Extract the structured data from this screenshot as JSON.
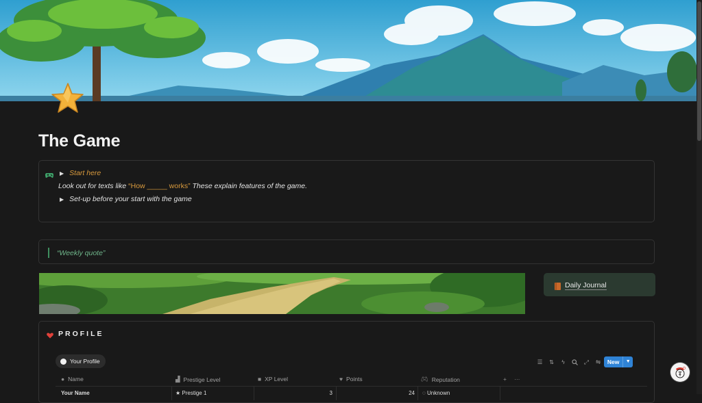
{
  "page": {
    "title": "The Game",
    "icon": "star-icon"
  },
  "callout": {
    "icon": "gamepad-icon",
    "toggle_start": "Start here",
    "hint_prefix": "Look out for texts like ",
    "hint_highlight": "“How _____ works”",
    "hint_suffix": " These explain features of the game.",
    "toggle_setup": "Set-up before your start with the game"
  },
  "quote": {
    "text": "“Weekly quote”"
  },
  "journal": {
    "label": "Daily Journal",
    "icon": "book-icon"
  },
  "profile": {
    "icon": "heart-icon",
    "title": "PROFILE",
    "view_tab": "Your Profile",
    "new_button": "New",
    "toolbar_icons": [
      "filter-icon",
      "sort-icon",
      "lightning-icon",
      "search-icon",
      "expand-icon",
      "settings-icon"
    ],
    "columns": [
      {
        "label": "Name",
        "icon": "circle-icon"
      },
      {
        "label": "Prestige Level",
        "icon": "bar-chart-icon"
      },
      {
        "label": "XP Level",
        "icon": "square-icon"
      },
      {
        "label": "Points",
        "icon": "heart-icon"
      },
      {
        "label": "Reputation",
        "icon": "gamepad-icon"
      }
    ],
    "row": {
      "name": "Your Name",
      "prestige": "Prestige 1",
      "xp": "3",
      "points": "24",
      "reputation": "Unknown"
    }
  },
  "colors": {
    "accent_blue": "#2f83d6",
    "highlight_orange": "#d99a3d",
    "quote_green": "#6fb58a",
    "journal_bg": "#2b3a30"
  }
}
